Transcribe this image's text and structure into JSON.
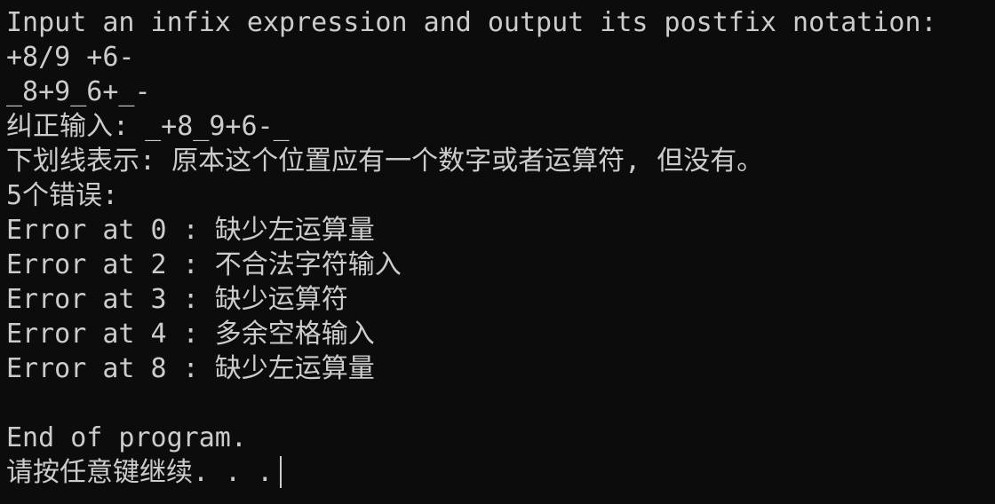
{
  "console": {
    "lines": [
      "Input an infix expression and output its postfix notation:",
      "+8/9 +6-",
      "_8+9_6+_-",
      "纠正输入: _+8_9+6-_",
      "下划线表示: 原本这个位置应有一个数字或者运算符, 但没有。",
      "5个错误:",
      "Error at 0 : 缺少左运算量",
      "Error at 2 : 不合法字符输入",
      "Error at 3 : 缺少运算符",
      "Error at 4 : 多余空格输入",
      "Error at 8 : 缺少左运算量",
      "",
      "End of program.",
      "请按任意键继续. . ."
    ]
  }
}
